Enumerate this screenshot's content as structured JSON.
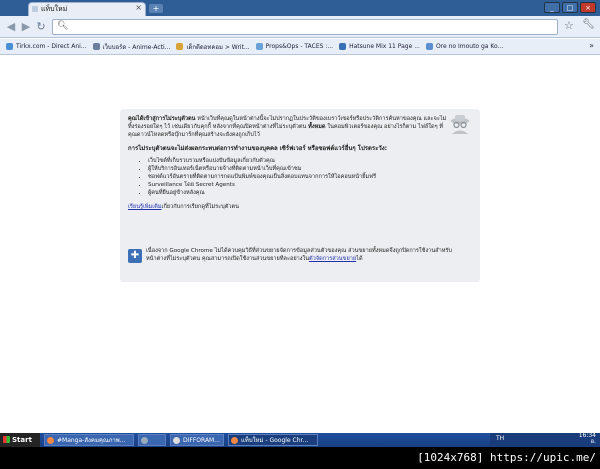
{
  "window": {
    "tab_title": "แท็บใหม่",
    "new_tab": "+"
  },
  "toolbar": {
    "omnibox_value": "",
    "search_icon": "magnifier-icon"
  },
  "bookmarks": [
    {
      "label": "Tirkx.com - Direct Ani...",
      "color": "#4a8fd6"
    },
    {
      "label": "เว็บบอร์ด - Anime-Acti...",
      "color": "#6a7f9b"
    },
    {
      "label": "เด็กดีดอทคอม > Writ...",
      "color": "#d8a43a"
    },
    {
      "label": "Props&Ops - TACES :...",
      "color": "#6aa2d8"
    },
    {
      "label": "Hatsune Mix 11 Page ...",
      "color": "#3a6fb5"
    },
    {
      "label": "Ore no Imouto ga Ko...",
      "color": "#5c8fd2"
    }
  ],
  "incognito": {
    "lead_bold": "คุณได้เข้าสู่การไม่ระบุตัวตน",
    "lead_rest": " หน้าเว็บที่คุณดูในหน้าต่างนี้จะไม่ปรากฏในประวัติของเบราว์เซอร์หรือประวัติการค้นหาของคุณ และจะไม่ทิ้งร่องรอยใดๆ ไว้ เช่นเดียวกับคุกกี้ หลังจากที่คุณปิดหน้าต่างที่ไม่ระบุตัวตน ",
    "lead_bold2": "ทั้งหมด",
    "lead_tail": " ในคอมพิวเตอร์ของคุณ อย่างไรก็ตาม ไฟล์ใดๆ ที่คุณดาวน์โหลดหรือบุ๊กมาร์กที่คุณสร้างจะยังคงถูกเก็บไว้",
    "heading": "การไม่ระบุตัวตนจะไม่ส่งผลกระทบต่อการทำงานของบุคคล เซิร์ฟเวอร์ หรือซอฟต์แวร์อื่นๆ โปรดระวัง:",
    "bullets": [
      "เว็บไซต์ที่เก็บรวบรวมหรือแบ่งปันข้อมูลเกี่ยวกับตัวคุณ",
      "ผู้ให้บริการอินเทอร์เน็ตหรือนายจ้างที่ติดตามหน้าเว็บที่คุณเข้าชม",
      "ซอฟต์แวร์อันตรายที่ติดตามการกดแป้นพิมพ์ของคุณเป็นสิ่งตอบแทนจากการให้ไอคอนหน้ายิ้มฟรี",
      "Surveillance โดย Secret Agents",
      "ผู้คนที่ยืนอยู่ข้างหลังคุณ"
    ],
    "learn_link": "เรียนรู้เพิ่มเติม",
    "learn_rest": "เกี่ยวกับการเรียกดูที่ไม่ระบุตัวตน",
    "ext_text": "เนื่องจาก Google Chrome ไม่ได้ควบคุมวิธีที่ส่วนขยายจัดการข้อมูลส่วนตัวของคุณ ส่วนขยายทั้งหมดจึงถูกปิดการใช้งานสำหรับหน้าต่างที่ไม่ระบุตัวตน คุณสามารถเปิดใช้งานส่วนขยายทีละอย่างใน",
    "ext_link": "ตัวจัดการส่วนขยาย",
    "ext_tail": "ได้"
  },
  "taskbar": {
    "start": "Start",
    "tasks": [
      {
        "label": "#Manga-สังคมคุณภาพ...",
        "active": false
      },
      {
        "label": "",
        "active": false
      },
      {
        "label": "DIFFORAM...",
        "active": false
      },
      {
        "label": "แท็บใหม่ - Google Chr...",
        "active": true
      }
    ],
    "lang": "TH",
    "clock_time": "16:34",
    "clock_day": "อ."
  },
  "caption": "[1024x768] https://upic.me/"
}
